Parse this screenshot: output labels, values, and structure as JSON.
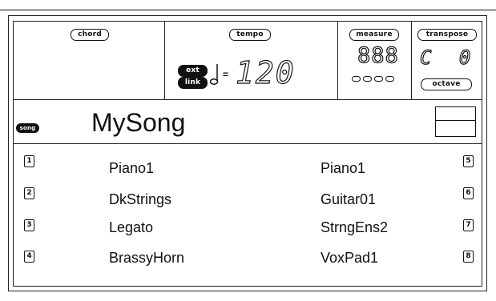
{
  "header": {
    "chord_label": "chord",
    "tempo_label": "tempo",
    "ext_label": "ext",
    "link_label": "link",
    "tempo_equals": "=",
    "tempo_value": "120",
    "measure_label": "measure",
    "measure_value": "888",
    "transpose_label": "transpose",
    "transpose_value": "C 0",
    "octave_label": "octave"
  },
  "song": {
    "tag": "song",
    "name": "MySong"
  },
  "tracks": [
    {
      "num": "1",
      "name": "Piano1"
    },
    {
      "num": "2",
      "name": "DkStrings"
    },
    {
      "num": "3",
      "name": "Legato"
    },
    {
      "num": "4",
      "name": "BrassyHorn"
    },
    {
      "num": "5",
      "name": "Piano1"
    },
    {
      "num": "6",
      "name": "Guitar01"
    },
    {
      "num": "7",
      "name": "StrngEns2"
    },
    {
      "num": "8",
      "name": "VoxPad1"
    }
  ]
}
